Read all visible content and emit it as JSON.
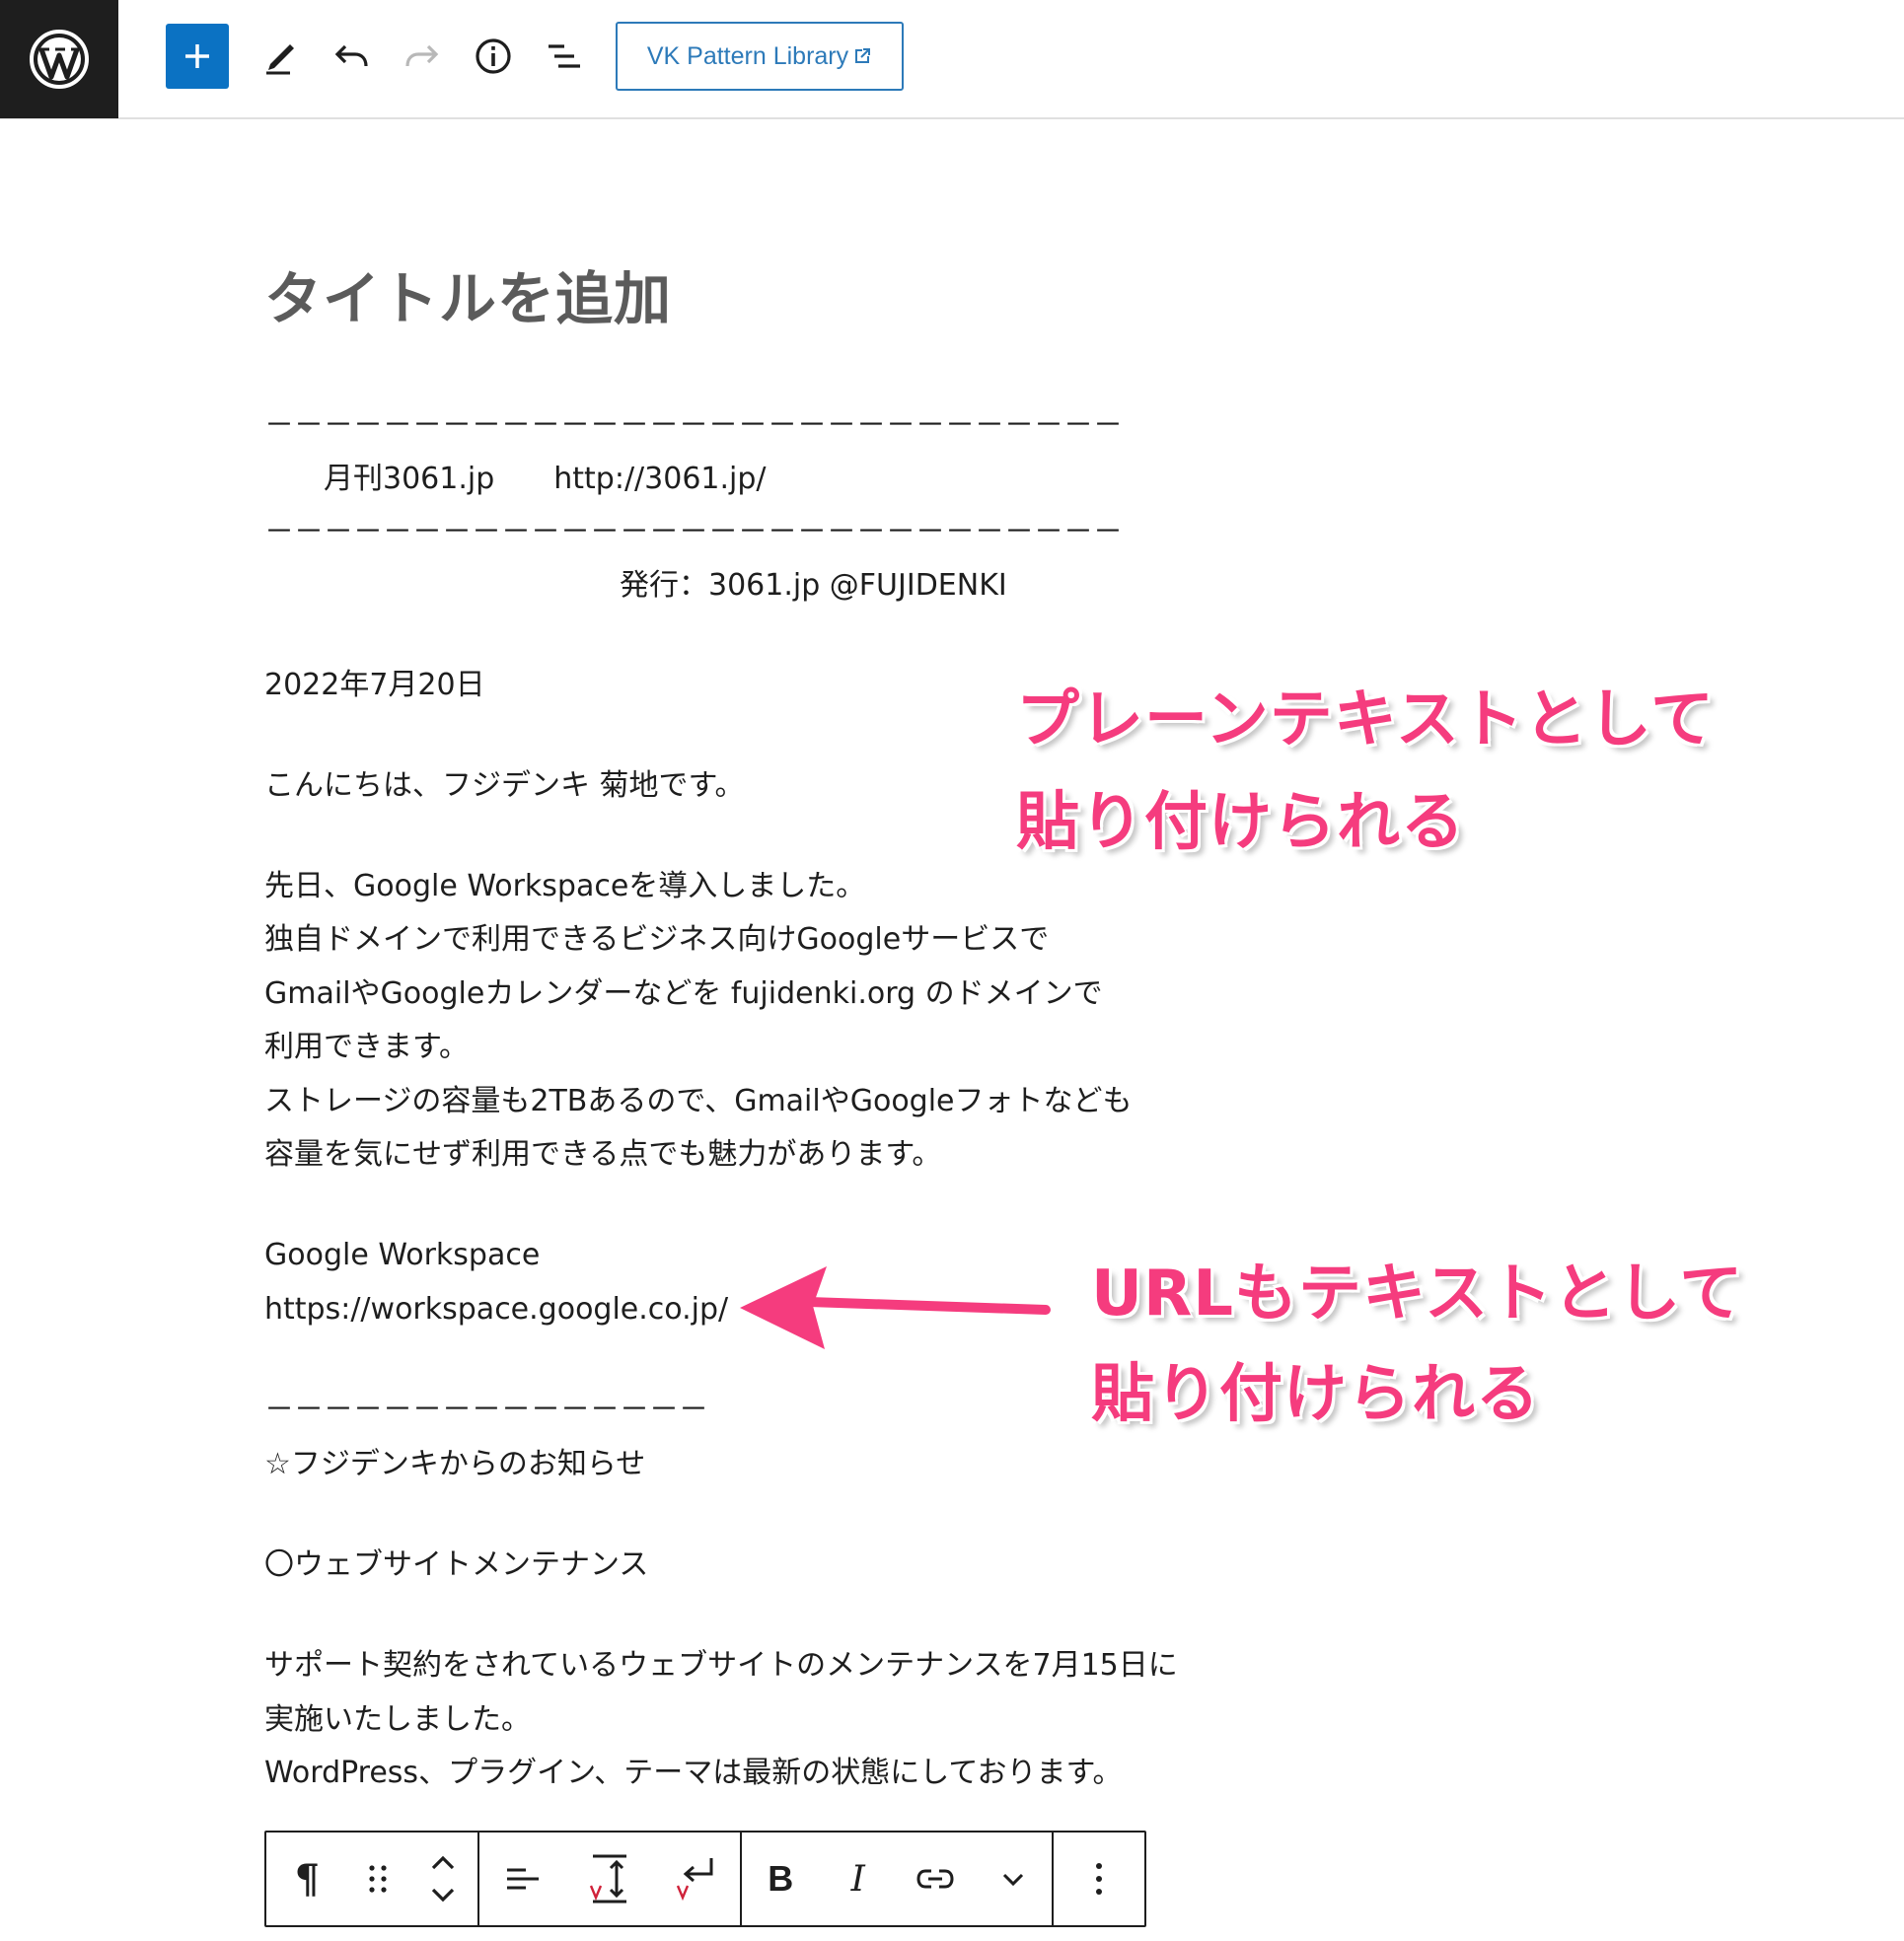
{
  "toolbar": {
    "pattern_library_label": "VK Pattern Library",
    "icons": [
      "wordpress-logo",
      "add",
      "edit-tools",
      "undo",
      "redo",
      "details-info",
      "list-view",
      "external-link"
    ]
  },
  "editor": {
    "title_placeholder": "タイトルを追加",
    "lines": [
      "－－－－－－－－－－－－－－－－－－－－－－－－－－－－－",
      "　　月刊3061.jp　　http://3061.jp/",
      "－－－－－－－－－－－－－－－－－－－－－－－－－－－－－",
      "　　　　　　　　　　　　発行：3061.jp @FUJIDENKI",
      "2022年7月20日",
      "こんにちは、フジデンキ 菊地です。",
      "先日、Google Workspaceを導入しました。",
      "独自ドメインで利用できるビジネス向けGoogleサービスで",
      "GmailやGoogleカレンダーなどを fujidenki.org のドメインで",
      "利用できます。",
      "ストレージの容量も2TBあるので、GmailやGoogleフォトなども",
      "容量を気にせず利用できる点でも魅力があります。",
      "Google Workspace",
      "https://workspace.google.co.jp/",
      "－－－－－－－－－－－－－－－",
      "☆フジデンキからのお知らせ",
      "〇ウェブサイトメンテナンス",
      "サポート契約をされているウェブサイトのメンテナンスを7月15日に",
      "実施いたしました。",
      "WordPress、プラグイン、テーマは最新の状態にしております。"
    ]
  },
  "annotations": {
    "top_line1": "プレーンテキストとして",
    "top_line2": "貼り付けられる",
    "bottom_line1": "URLもテキストとして",
    "bottom_line2": "貼り付けられる",
    "color": "#f53c7e"
  },
  "block_toolbar": {
    "paragraph_glyph": "¶",
    "bold_glyph": "B",
    "italic_glyph": "I",
    "icons": [
      "paragraph",
      "drag-handle",
      "move-up-down",
      "align",
      "line-height",
      "line-break",
      "bold",
      "italic",
      "link",
      "more-rich-text",
      "options"
    ]
  },
  "colors": {
    "accent": "#0b72c3",
    "topbar_dark": "#1e1e1e",
    "annotation": "#f53c7e"
  }
}
